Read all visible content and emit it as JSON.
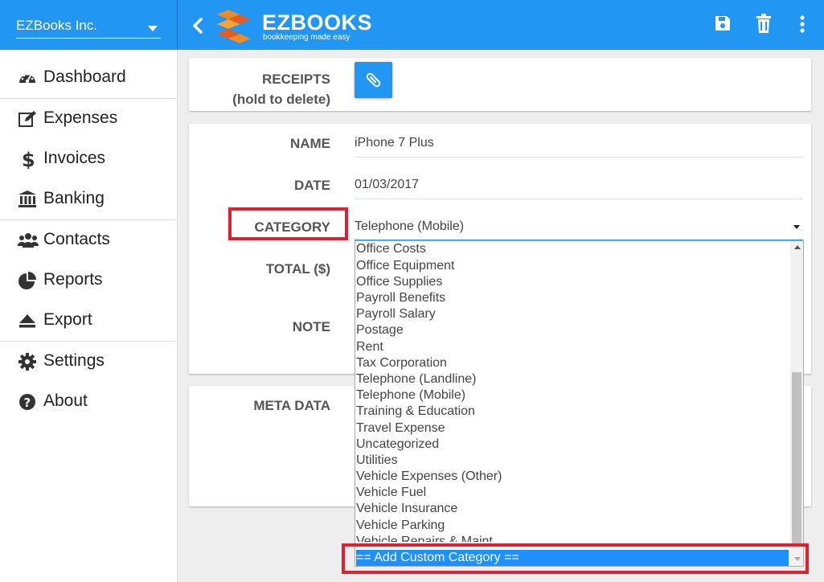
{
  "colors": {
    "primary": "#2196f3",
    "highlight": "#e0202e",
    "selected": "#1e90ff"
  },
  "header": {
    "company": "EZBooks Inc.",
    "brand": "EZBOOKS",
    "tagline": "bookkeeping made easy",
    "icons": [
      "back-icon",
      "save-icon",
      "trash-icon",
      "more-vert-icon"
    ]
  },
  "sidebar": {
    "items": [
      {
        "label": "Dashboard",
        "icon": "dashboard-icon"
      },
      {
        "label": "Expenses",
        "icon": "edit-icon"
      },
      {
        "label": "Invoices",
        "icon": "dollar-icon"
      },
      {
        "label": "Banking",
        "icon": "bank-icon"
      },
      {
        "label": "Contacts",
        "icon": "users-icon"
      },
      {
        "label": "Reports",
        "icon": "pie-chart-icon"
      },
      {
        "label": "Export",
        "icon": "eject-icon"
      },
      {
        "label": "Settings",
        "icon": "gear-icon"
      },
      {
        "label": "About",
        "icon": "question-icon"
      }
    ]
  },
  "receipts": {
    "label": "RECEIPTS",
    "sublabel": "(hold to delete)",
    "icon": "paperclip-icon"
  },
  "form": {
    "name_label": "NAME",
    "name_value": "iPhone 7 Plus",
    "date_label": "DATE",
    "date_value": "01/03/2017",
    "category_label": "CATEGORY",
    "category_value": "Telephone (Mobile)",
    "total_label": "TOTAL ($)",
    "note_label": "NOTE"
  },
  "meta": {
    "label": "META DATA"
  },
  "dropdown": {
    "options": [
      "Office Costs",
      "Office Equipment",
      "Office Supplies",
      "Payroll Benefits",
      "Payroll Salary",
      "Postage",
      "Rent",
      "Tax Corporation",
      "Telephone (Landline)",
      "Telephone (Mobile)",
      "Training & Education",
      "Travel Expense",
      "Uncategorized",
      "Utilities",
      "Vehicle Expenses (Other)",
      "Vehicle Fuel",
      "Vehicle Insurance",
      "Vehicle Parking",
      "Vehicle Repairs & Maint"
    ],
    "selected_option": "== Add Custom Category =="
  }
}
